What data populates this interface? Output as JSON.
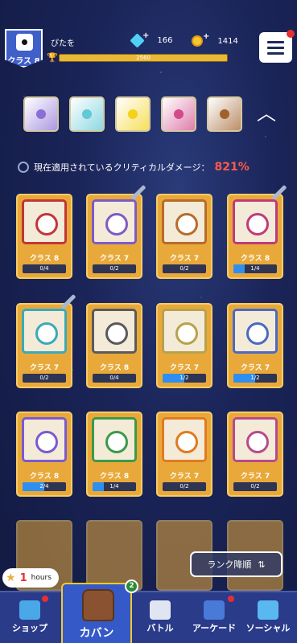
{
  "header": {
    "rank_label": "クラス 8",
    "player_name": "ぴたを",
    "gems": "166",
    "coins": "1414",
    "xp_value": "2560"
  },
  "deck": {
    "dice": [
      {
        "icon": "purple-die-icon",
        "color": "#8a6fd6"
      },
      {
        "icon": "ice-die-icon",
        "color": "#5fc9d6"
      },
      {
        "icon": "yellow-die-icon",
        "color": "#f4d21a"
      },
      {
        "icon": "infinity-die-icon",
        "color": "#d24a8a"
      },
      {
        "icon": "brown-die-icon",
        "color": "#a0612c"
      }
    ]
  },
  "crit": {
    "label": "現在適用されているクリティカルダメージ：",
    "value": "821%"
  },
  "cards": [
    {
      "icon": "fire-star-die-icon",
      "color": "#c23636",
      "class": "クラス 8",
      "count": "0/4",
      "progress": 0,
      "sword": false
    },
    {
      "icon": "purple-die-icon",
      "color": "#7d5bc6",
      "class": "クラス 7",
      "count": "0/2",
      "progress": 0,
      "sword": true
    },
    {
      "icon": "lightning-die-icon",
      "color": "#b86b2a",
      "class": "クラス 7",
      "count": "0/2",
      "progress": 0,
      "sword": false
    },
    {
      "icon": "infinity-die-icon",
      "color": "#c23a7a",
      "class": "クラス 8",
      "count": "1/4",
      "progress": 0.25,
      "sword": true
    },
    {
      "icon": "ice-die-icon",
      "color": "#3aaab8",
      "class": "クラス 7",
      "count": "0/2",
      "progress": 0,
      "sword": true
    },
    {
      "icon": "skull-die-icon",
      "color": "#5a5a5a",
      "class": "クラス 8",
      "count": "0/4",
      "progress": 0,
      "sword": false
    },
    {
      "icon": "shield-die-icon",
      "color": "#b8a24a",
      "class": "クラス 7",
      "count": "1/2",
      "progress": 0.5,
      "sword": false
    },
    {
      "icon": "snow-die-icon",
      "color": "#4a6ac2",
      "class": "クラス 7",
      "count": "1/2",
      "progress": 0.5,
      "sword": false
    },
    {
      "icon": "orb-die-icon",
      "color": "#7a5ad2",
      "class": "クラス 8",
      "count": "2/4",
      "progress": 0.5,
      "sword": false
    },
    {
      "icon": "wind-die-icon",
      "color": "#3a9a4a",
      "class": "クラス 8",
      "count": "1/4",
      "progress": 0.25,
      "sword": false
    },
    {
      "icon": "sun-die-icon",
      "color": "#e07a20",
      "class": "クラス 7",
      "count": "0/2",
      "progress": 0,
      "sword": false
    },
    {
      "icon": "dragon-die-icon",
      "color": "#b84a8a",
      "class": "クラス 7",
      "count": "0/2",
      "progress": 0,
      "sword": false
    }
  ],
  "sort_button": {
    "label": "ランク降順"
  },
  "timer": {
    "value": "1",
    "unit": "hours"
  },
  "nav": {
    "shop": "ショップ",
    "bag": "カバン",
    "bag_badge": "2",
    "battle": "バトル",
    "arcade": "アーケード",
    "social": "ソーシャル"
  }
}
